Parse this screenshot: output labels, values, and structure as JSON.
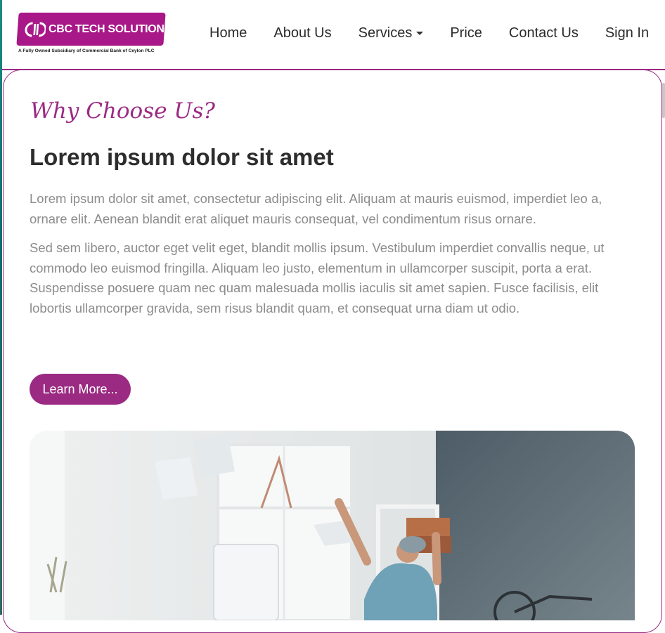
{
  "header": {
    "logo_text": "CBC TECH SOLUTIONS",
    "logo_tagline": "A Fully Owned Subsidiary of Commercial Bank of Ceylon PLC",
    "nav": [
      {
        "label": "Home"
      },
      {
        "label": "About Us"
      },
      {
        "label": "Services",
        "has_dropdown": true
      },
      {
        "label": "Price"
      },
      {
        "label": "Contact Us"
      },
      {
        "label": "Sign In"
      }
    ]
  },
  "section": {
    "kicker": "Why Choose Us?",
    "heading": "Lorem ipsum dolor sit amet",
    "paragraphs": [
      "Lorem ipsum dolor sit amet, consectetur adipiscing elit. Aliquam at mauris euismod, imperdiet leo a, ornare elit. Aenean blandit erat aliquet mauris consequat, vel condimentum risus ornare.",
      "Sed sem libero, auctor eget velit eget, blandit mollis ipsum. Vestibulum imperdiet convallis neque, ut commodo leo euismod fringilla. Aliquam leo justo, elementum in ullamcorper suscipit, porta a erat. Suspendisse posuere quam nec quam malesuada mollis iaculis sit amet sapien. Fusce facilisis, elit lobortis ullamcorper gravida, sem risus blandit quam, et consequat urna diam ut odio."
    ],
    "button_label": "Learn More..."
  },
  "colors": {
    "brand": "#9b2a83",
    "heading": "#2d2d2d",
    "body_text": "#8c8c8c"
  },
  "icons": {
    "logo_mark": "cbc-logo-icon",
    "dropdown": "caret-down-icon"
  }
}
